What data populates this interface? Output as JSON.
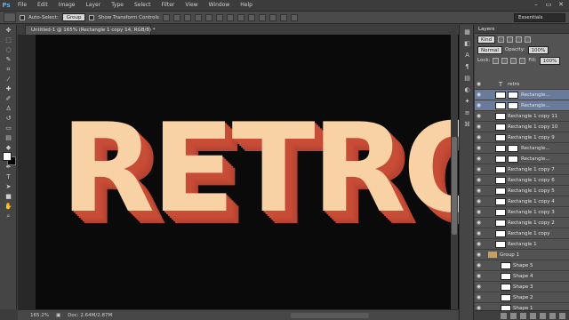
{
  "menubar": {
    "logo": "Ps",
    "items": [
      "File",
      "Edit",
      "Image",
      "Layer",
      "Type",
      "Select",
      "Filter",
      "View",
      "Window",
      "Help"
    ],
    "window_controls": [
      "–",
      "▭",
      "✕"
    ]
  },
  "options": {
    "auto_select_label": "Auto-Select:",
    "auto_select_value": "Group",
    "transform_label": "Show Transform Controls",
    "workspace": "Essentials"
  },
  "document": {
    "tab_title": "Untitled-1 @ 165% (Rectangle 1 copy 14, RGB/8) *",
    "text": "RETRO",
    "colors": {
      "face": "#f8d2a4",
      "extrude": "#c74d37",
      "canvas": "#0a0a0a"
    }
  },
  "status": {
    "zoom": "165.2%",
    "doc_info": "Doc: 2.64M/2.87M"
  },
  "layers_panel": {
    "title": "Layers",
    "filter_kind": "Kind",
    "blend_mode": "Normal",
    "opacity_label": "Opacity:",
    "opacity_value": "100%",
    "lock_label": "Lock:",
    "fill_label": "Fill:",
    "fill_value": "100%",
    "layers": [
      {
        "name": "retro",
        "type": "text",
        "selected": false
      },
      {
        "name": "Rectangle...",
        "type": "mask",
        "selected": true
      },
      {
        "name": "Rectangle...",
        "type": "mask",
        "selected": true
      },
      {
        "name": "Rectangle 1 copy 11",
        "type": "shape",
        "selected": false
      },
      {
        "name": "Rectangle 1 copy 10",
        "type": "shape",
        "selected": false
      },
      {
        "name": "Rectangle 1 copy 9",
        "type": "shape",
        "selected": false
      },
      {
        "name": "Rectangle...",
        "type": "mask",
        "selected": false
      },
      {
        "name": "Rectangle...",
        "type": "mask",
        "selected": false
      },
      {
        "name": "Rectangle 1 copy 7",
        "type": "shape",
        "selected": false
      },
      {
        "name": "Rectangle 1 copy 6",
        "type": "shape",
        "selected": false
      },
      {
        "name": "Rectangle 1 copy 5",
        "type": "shape",
        "selected": false
      },
      {
        "name": "Rectangle 1 copy 4",
        "type": "shape",
        "selected": false
      },
      {
        "name": "Rectangle 1 copy 3",
        "type": "shape",
        "selected": false
      },
      {
        "name": "Rectangle 1 copy 2",
        "type": "shape",
        "selected": false
      },
      {
        "name": "Rectangle 1 copy",
        "type": "shape",
        "selected": false
      },
      {
        "name": "Rectangle 1",
        "type": "shape",
        "selected": false
      },
      {
        "name": "Group 1",
        "type": "group",
        "selected": false
      },
      {
        "name": "Shape 5",
        "type": "child",
        "selected": false
      },
      {
        "name": "Shape 4",
        "type": "child",
        "selected": false
      },
      {
        "name": "Shape 3",
        "type": "child",
        "selected": false
      },
      {
        "name": "Shape 2",
        "type": "child",
        "selected": false
      },
      {
        "name": "Shape 1",
        "type": "child",
        "selected": false
      }
    ]
  }
}
